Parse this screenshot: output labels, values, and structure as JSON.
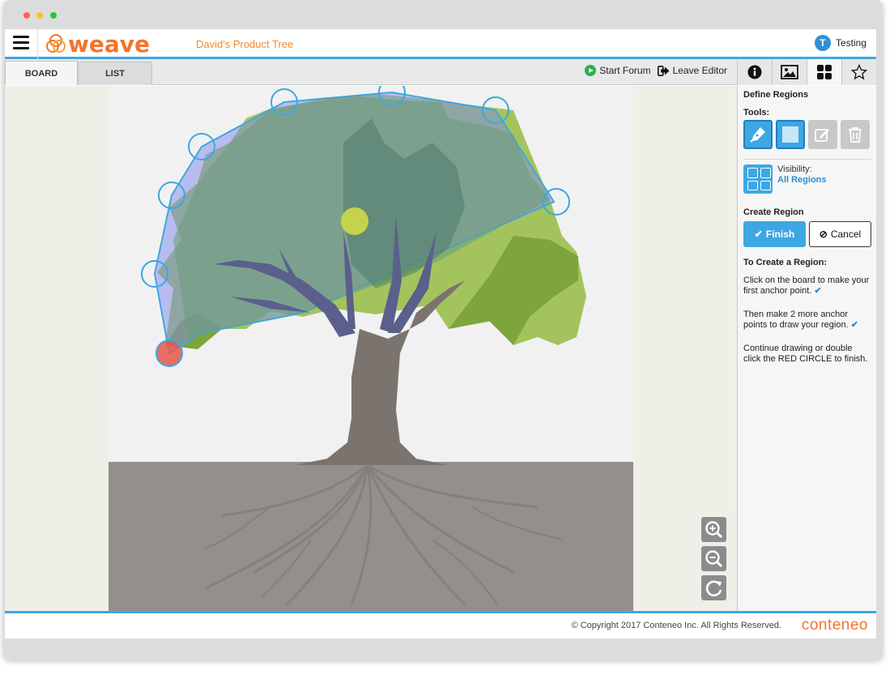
{
  "window": {
    "title": ""
  },
  "header": {
    "logo_text": "weave",
    "board_title": "David's Product Tree",
    "user_initial": "T",
    "user_name": "Testing"
  },
  "toolbar": {
    "tabs": [
      {
        "label": "BOARD",
        "active": true
      },
      {
        "label": "LIST",
        "active": false
      }
    ],
    "start_forum_label": "Start Forum",
    "leave_editor_label": "Leave Editor"
  },
  "side_tabs": [
    {
      "icon": "info-icon",
      "active": false
    },
    {
      "icon": "image-icon",
      "active": false
    },
    {
      "icon": "regions-grid-icon",
      "active": true
    },
    {
      "icon": "star-icon",
      "active": false
    }
  ],
  "panel": {
    "title": "Define Regions",
    "tools_label": "Tools:",
    "tools": [
      "pen-icon",
      "rectangle-icon",
      "edit-icon",
      "trash-icon"
    ],
    "visibility_label": "Visibility:",
    "visibility_value": "All Regions",
    "create_region_label": "Create Region",
    "finish_label": "Finish",
    "cancel_label": "Cancel",
    "how_to_title": "To Create a Region:",
    "steps": [
      "Click on the board to make your first anchor point.",
      "Then make 2 more anchor points to draw your region.",
      "Continue drawing or double click the RED CIRCLE to finish."
    ]
  },
  "zoom": [
    "zoom-in-icon",
    "zoom-out-icon",
    "reset-icon"
  ],
  "footer": {
    "copyright": "© Copyright 2017 Conteneo Inc. All Rights Reserved.",
    "brand": "conteneo"
  },
  "colors": {
    "accent": "#3da7e3",
    "brand_orange": "#f3742b",
    "region_fill": "#7d87ec",
    "anchor_stroke": "#3da7e3",
    "first_anchor": "#e5574a"
  }
}
